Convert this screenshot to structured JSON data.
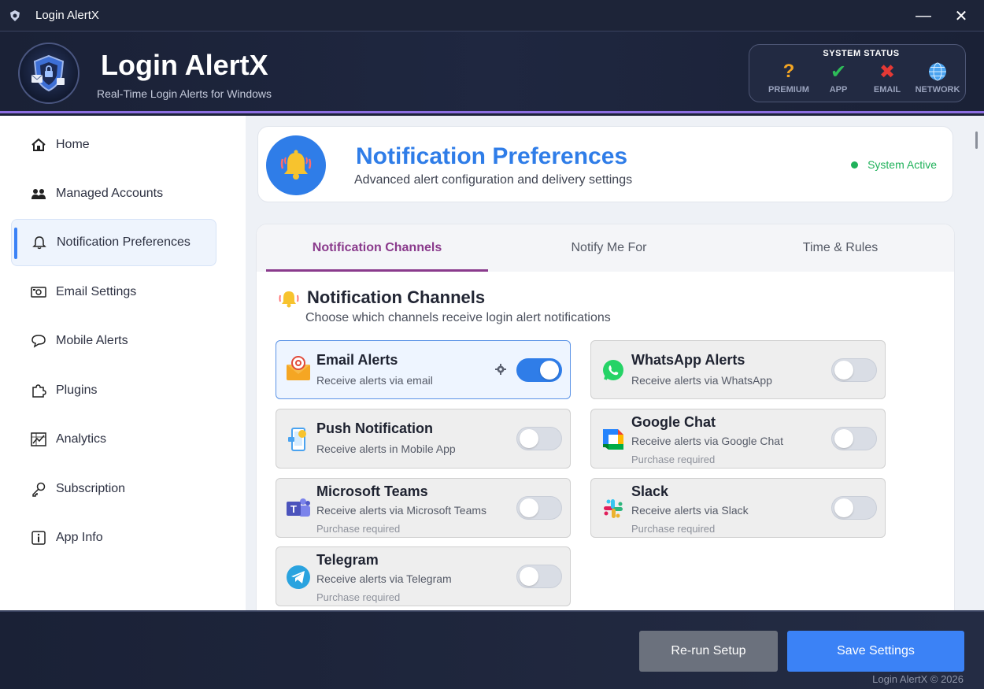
{
  "window": {
    "title": "Login AlertX",
    "minimize_label": "—",
    "close_label": "✕"
  },
  "header": {
    "app_name": "Login AlertX",
    "subtitle": "Real-Time Login Alerts for Windows",
    "system_status": {
      "title": "SYSTEM STATUS",
      "items": [
        {
          "label": "PREMIUM",
          "icon": "question-icon",
          "glyph": "?",
          "color": "#f5a623"
        },
        {
          "label": "APP",
          "icon": "check-icon",
          "glyph": "✔",
          "color": "#2ebd59"
        },
        {
          "label": "EMAIL",
          "icon": "cross-icon",
          "glyph": "✖",
          "color": "#e53935"
        },
        {
          "label": "NETWORK",
          "icon": "globe-icon",
          "glyph": "",
          "color": "#4aa3f0"
        }
      ]
    }
  },
  "sidebar": {
    "items": [
      {
        "label": "Home",
        "icon": "home-icon",
        "glyph": "⌂",
        "active": false
      },
      {
        "label": "Managed Accounts",
        "icon": "users-icon",
        "glyph": "👥",
        "active": false
      },
      {
        "label": "Notification Preferences",
        "icon": "bell-icon",
        "glyph": "🔔",
        "active": true
      },
      {
        "label": "Email Settings",
        "icon": "email-icon",
        "glyph": "✉",
        "active": false
      },
      {
        "label": "Mobile Alerts",
        "icon": "chat-bubble-icon",
        "glyph": "💬",
        "active": false
      },
      {
        "label": "Plugins",
        "icon": "puzzle-icon",
        "glyph": "✣",
        "active": false
      },
      {
        "label": "Analytics",
        "icon": "chart-icon",
        "glyph": "📈",
        "active": false
      },
      {
        "label": "Subscription",
        "icon": "key-icon",
        "glyph": "⚷",
        "active": false
      },
      {
        "label": "App Info",
        "icon": "info-icon",
        "glyph": "ⓘ",
        "active": false
      }
    ]
  },
  "page": {
    "title": "Notification Preferences",
    "subtitle": "Advanced alert configuration and delivery settings",
    "status": "System Active"
  },
  "tabs": [
    {
      "label": "Notification Channels",
      "active": true
    },
    {
      "label": "Notify Me For",
      "active": false
    },
    {
      "label": "Time & Rules",
      "active": false
    }
  ],
  "section": {
    "title": "Notification Channels",
    "subtitle": "Choose which channels receive login alert notifications"
  },
  "channels": [
    {
      "name": "Email Alerts",
      "desc": "Receive alerts via email",
      "note": "",
      "enabled": true,
      "icon": "email-alert-icon"
    },
    {
      "name": "WhatsApp Alerts",
      "desc": "Receive alerts via WhatsApp",
      "note": "",
      "enabled": false,
      "icon": "whatsapp-icon"
    },
    {
      "name": "Push Notification",
      "desc": "Receive alerts in Mobile App",
      "note": "",
      "enabled": false,
      "icon": "mobile-push-icon"
    },
    {
      "name": "Google Chat",
      "desc": "Receive alerts via Google Chat",
      "note": "Purchase required",
      "enabled": false,
      "icon": "google-chat-icon"
    },
    {
      "name": "Microsoft Teams",
      "desc": "Receive alerts via Microsoft Teams",
      "note": "Purchase required",
      "enabled": false,
      "icon": "teams-icon"
    },
    {
      "name": "Slack",
      "desc": "Receive alerts via Slack",
      "note": "Purchase required",
      "enabled": false,
      "icon": "slack-icon"
    },
    {
      "name": "Telegram",
      "desc": "Receive alerts via Telegram",
      "note": "Purchase required",
      "enabled": false,
      "icon": "telegram-icon"
    }
  ],
  "footer": {
    "rerun_label": "Re-run Setup",
    "save_label": "Save Settings",
    "copyright": "Login AlertX © 2026"
  },
  "colors": {
    "accent": "#3b82f6",
    "tab_active": "#8a3a8c",
    "title_blue": "#2f7de8",
    "status_green": "#1fb15a"
  }
}
